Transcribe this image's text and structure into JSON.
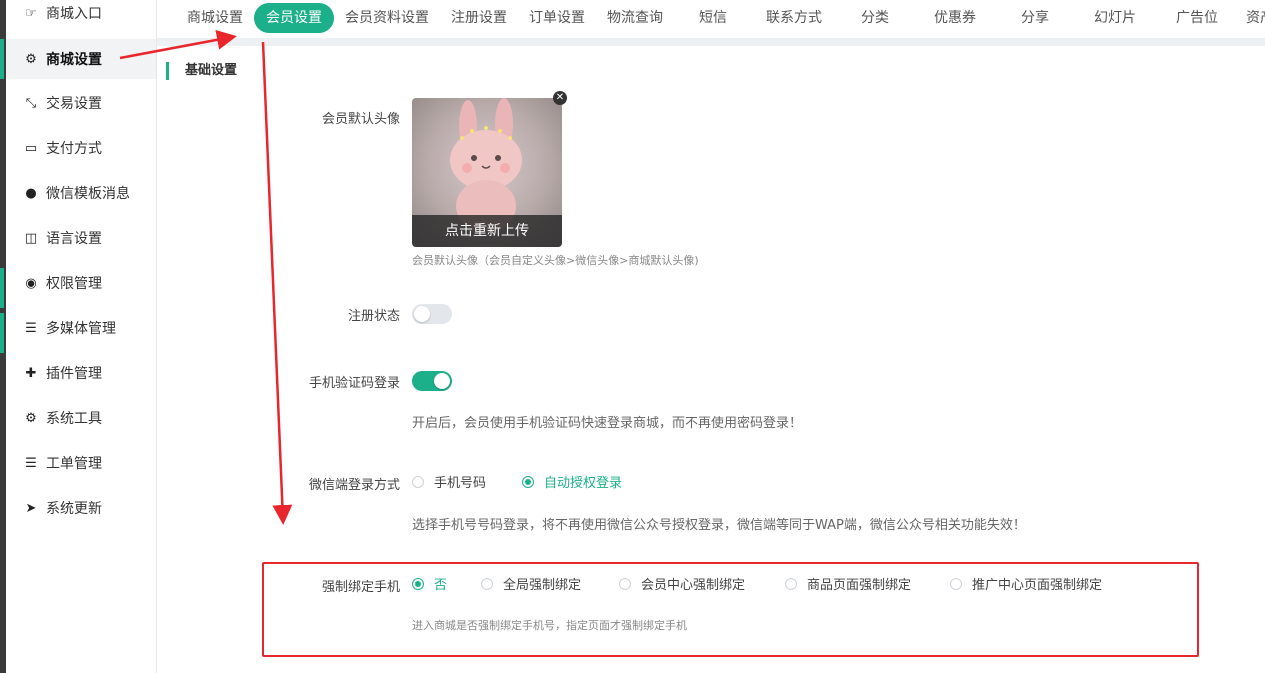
{
  "sidebar": {
    "items": [
      {
        "label": "商城入口",
        "icon": "thumb-pointer-icon"
      },
      {
        "label": "商城设置",
        "icon": "gear-icon"
      },
      {
        "label": "交易设置",
        "icon": "compress-arrows-icon"
      },
      {
        "label": "支付方式",
        "icon": "credit-card-icon"
      },
      {
        "label": "微信模板消息",
        "icon": "wechat-icon"
      },
      {
        "label": "语言设置",
        "icon": "language-icon"
      },
      {
        "label": "权限管理",
        "icon": "gamepad-icon"
      },
      {
        "label": "多媒体管理",
        "icon": "list-icon"
      },
      {
        "label": "插件管理",
        "icon": "puzzle-icon"
      },
      {
        "label": "系统工具",
        "icon": "gear-icon"
      },
      {
        "label": "工单管理",
        "icon": "list-icon"
      },
      {
        "label": "系统更新",
        "icon": "paper-plane-icon"
      }
    ]
  },
  "tabs": [
    "商城设置",
    "会员设置",
    "会员资料设置",
    "注册设置",
    "订单设置",
    "物流查询",
    "短信",
    "联系方式",
    "分类",
    "优惠券",
    "分享",
    "幻灯片",
    "广告位",
    "资产"
  ],
  "section_title": "基础设置",
  "avatar": {
    "label": "会员默认头像",
    "reupload": "点击重新上传",
    "help": "会员默认头像（会员自定义头像>微信头像>商城默认头像)"
  },
  "register_status": {
    "label": "注册状态",
    "on": false
  },
  "sms_login": {
    "label": "手机验证码登录",
    "on": true,
    "help": "开启后，会员使用手机验证码快速登录商城，而不再使用密码登录！"
  },
  "wechat_login": {
    "label": "微信端登录方式",
    "options": [
      "手机号码",
      "自动授权登录"
    ],
    "selected": "自动授权登录",
    "help": "选择手机号号码登录，将不再使用微信公众号授权登录，微信端等同于WAP端，微信公众号相关功能失效！"
  },
  "force_bind": {
    "label": "强制绑定手机",
    "options": [
      "否",
      "全局强制绑定",
      "会员中心强制绑定",
      "商品页面强制绑定",
      "推广中心页面强制绑定"
    ],
    "selected": "否",
    "help": "进入商城是否强制绑定手机号，指定页面才强制绑定手机"
  },
  "colors": {
    "accent": "#1cb08a",
    "annotation": "#e8262b"
  }
}
